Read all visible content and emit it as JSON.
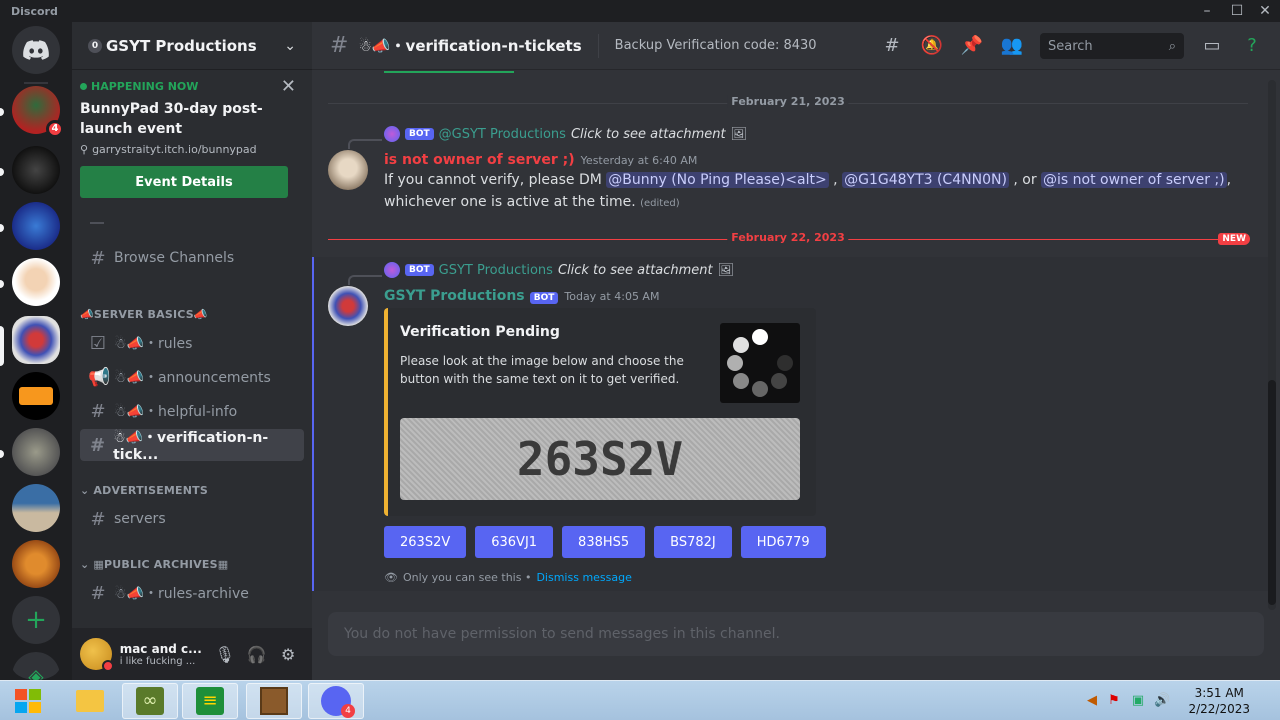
{
  "window": {
    "app_name": "Discord",
    "minimize": "–",
    "maximize": "☐",
    "close": "✕"
  },
  "rail": {
    "home_badge": "4",
    "profile_badge": "4",
    "add_server": "+",
    "explore": "◈"
  },
  "server": {
    "name": "GSYT Productions",
    "boost_icon": "0",
    "event": {
      "status": "HAPPENING NOW",
      "title": "BunnyPad 30-day post-launch event",
      "location": "garrystraityt.itch.io/bunnypad",
      "button": "Event Details"
    },
    "browse_channels": "Browse Channels",
    "categories": [
      {
        "label": "📣SERVER BASICS📣"
      },
      {
        "label": "ADVERTISEMENTS"
      },
      {
        "label": "▦PUBLIC ARCHIVES▦"
      }
    ],
    "channels": [
      {
        "label": "☃📣・rules"
      },
      {
        "label": "☃📣・announcements"
      },
      {
        "label": "☃📣・helpful-info"
      },
      {
        "label": "☃📣・verification-n-tick..."
      },
      {
        "label": "servers"
      },
      {
        "label": "☃📣・rules-archive"
      }
    ]
  },
  "user": {
    "name": "mac and c...",
    "status": "i like fucking ..."
  },
  "header": {
    "channel": "☃📣・verification-n-tickets",
    "topic": "Backup Verification code: 8430",
    "search_placeholder": "Search"
  },
  "messages": {
    "day1": "February 21, 2023",
    "day2": "February 22, 2023",
    "new_label": "NEW",
    "m1": {
      "reply_author": "@GSYT Productions",
      "reply_text": "Click to see attachment",
      "author": "is not owner of server ;)",
      "timestamp": "Yesterday at 6:40 AM",
      "text_a": "If you cannot verify, please DM ",
      "mention1": "@Bunny  (No Ping Please)<alt>",
      "text_b": " , ",
      "mention2": "@G1G48YT3 (C4NN0N)",
      "text_c": " , or ",
      "mention3": "@is not owner of server ;)",
      "text_d": ",",
      "text_e": "whichever one is active at the time.",
      "edited": "(edited)"
    },
    "m2": {
      "reply_author": "GSYT Productions",
      "reply_text": "Click to see attachment",
      "author": "GSYT Productions",
      "bot_tag": "BOT",
      "timestamp": "Today at 4:05 AM",
      "embed_title": "Verification Pending",
      "embed_desc": "Please look at the image below and choose the button with the same text on it to get verified.",
      "captcha_text": "263S2V",
      "buttons": [
        "263S2V",
        "636VJ1",
        "838HS5",
        "BS782J",
        "HD6779"
      ],
      "ephemeral": "Only you can see this •",
      "dismiss": "Dismiss message"
    }
  },
  "composer": {
    "placeholder": "You do not have permission to send messages in this channel."
  },
  "taskbar": {
    "time": "3:51 AM",
    "date": "2/22/2023",
    "discord_badge": "4"
  },
  "colors": {
    "accent": "#5865f2",
    "green": "#23a55a",
    "red": "#f23f43",
    "embed_bar": "#f0b232"
  }
}
